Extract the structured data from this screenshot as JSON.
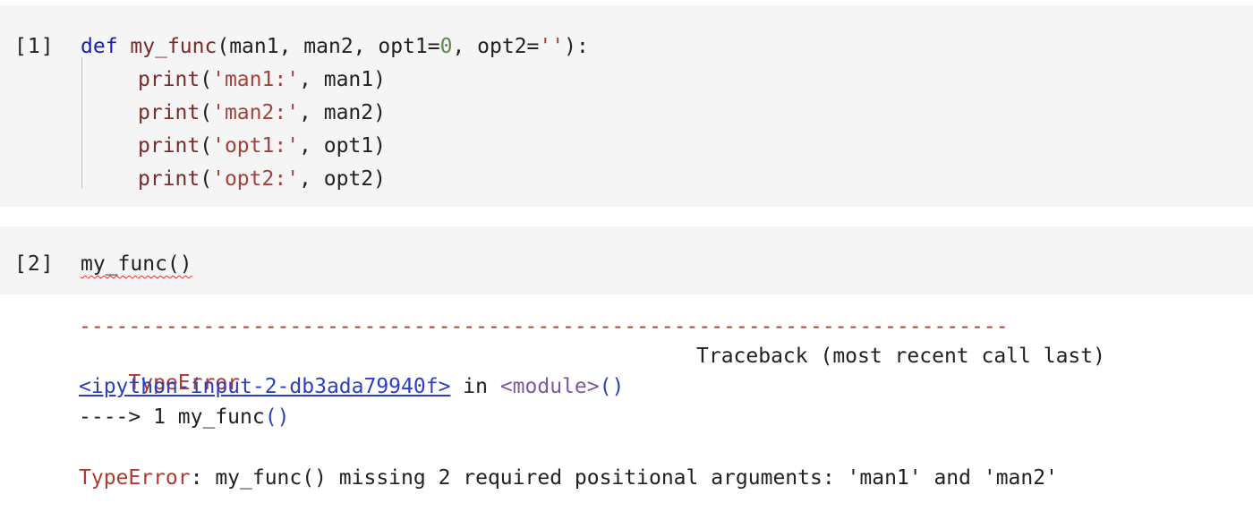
{
  "cells": [
    {
      "prompt": "[1]",
      "lines": [
        {
          "kw": "def",
          "name": "my_func",
          "args_a": "(man1, man2, opt1=",
          "num": "0",
          "args_b": ", opt2=",
          "str": "''",
          "tail": "):"
        },
        {
          "fn": "print",
          "open": "(",
          "str": "'man1:'",
          "rest": ", man1)"
        },
        {
          "fn": "print",
          "open": "(",
          "str": "'man2:'",
          "rest": ", man2)"
        },
        {
          "fn": "print",
          "open": "(",
          "str": "'opt1:'",
          "rest": ", opt1)"
        },
        {
          "fn": "print",
          "open": "(",
          "str": "'opt2:'",
          "rest": ", opt2)"
        }
      ]
    },
    {
      "prompt": "[2]",
      "code": "my_func()"
    }
  ],
  "output": {
    "separator": "---------------------------------------------------------------------------",
    "error_name": "TypeError",
    "traceback_label": "Traceback (most recent call last)",
    "input_link": "<ipython-input-2-db3ada79940f>",
    "in_word": " in ",
    "module": "<module>",
    "module_parens": "()",
    "arrow_line": "----> 1 my_func",
    "arrow_parens": "()",
    "final_error_name": "TypeError",
    "final_error_message": ": my_func() missing 2 required positional arguments: 'man1' and 'man2'"
  }
}
